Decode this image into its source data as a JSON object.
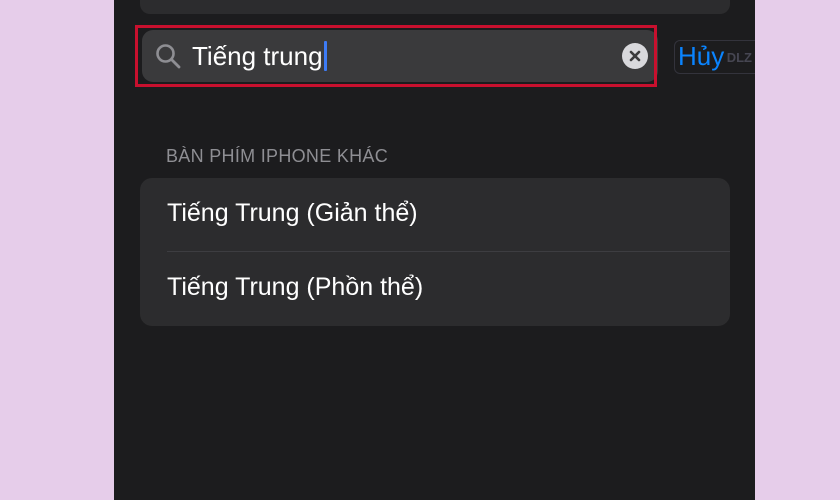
{
  "search": {
    "value": "Tiếng trung",
    "cancel_label": "Hủy"
  },
  "watermark": {
    "text": "DLZ TECH"
  },
  "section": {
    "header": "BÀN PHÍM IPHONE KHÁC",
    "items": [
      {
        "label": "Tiếng Trung (Giản thể)"
      },
      {
        "label": "Tiếng Trung (Phồn thể)"
      }
    ]
  },
  "icons": {
    "search": "search-icon",
    "clear": "clear-icon"
  },
  "colors": {
    "background": "#1c1c1e",
    "field": "#3a3a3c",
    "cell": "#2c2c2e",
    "accent": "#0a84ff",
    "highlight": "#c8102e",
    "secondary_text": "#8e8e93"
  }
}
